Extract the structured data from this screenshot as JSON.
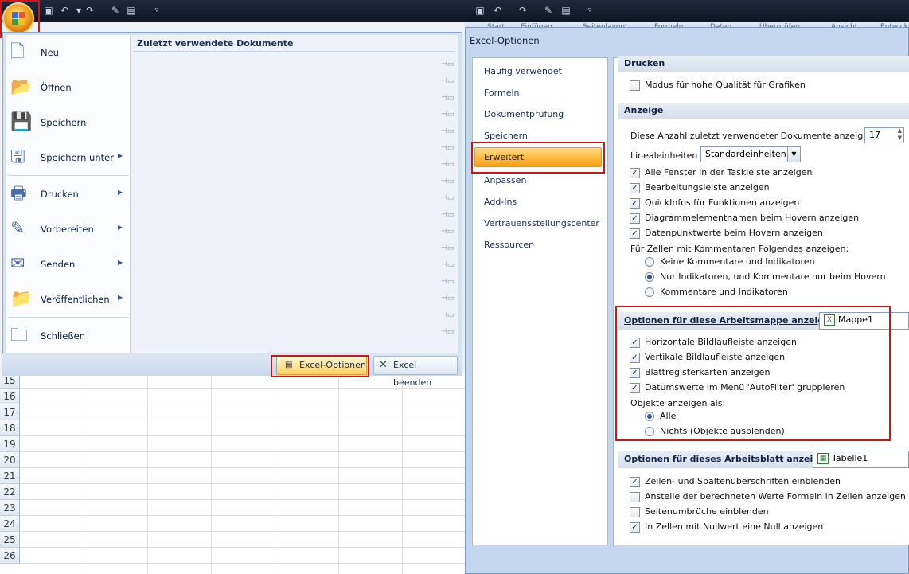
{
  "quick_access": {
    "icons": [
      "save-icon",
      "undo-icon",
      "redo-icon",
      "format-painter-icon",
      "print-preview-icon",
      "customize-arrow-icon"
    ]
  },
  "ribbon_tabs": [
    "Start",
    "Einfügen",
    "Seitenlayout",
    "Formeln",
    "Daten",
    "Überprüfen",
    "Ansicht",
    "Entwickl"
  ],
  "office_menu": {
    "items": [
      {
        "id": "neu",
        "label": "Neu",
        "has_submenu": false,
        "icon": "new-document-icon"
      },
      {
        "id": "oeffnen",
        "label": "Öffnen",
        "has_submenu": false,
        "icon": "open-folder-icon"
      },
      {
        "id": "speichern",
        "label": "Speichern",
        "has_submenu": false,
        "icon": "save-disk-icon"
      },
      {
        "id": "speichern-unter",
        "label": "Speichern unter",
        "has_submenu": true,
        "icon": "save-as-icon"
      },
      {
        "id": "drucken",
        "label": "Drucken",
        "has_submenu": true,
        "icon": "printer-icon"
      },
      {
        "id": "vorbereiten",
        "label": "Vorbereiten",
        "has_submenu": true,
        "icon": "prepare-icon"
      },
      {
        "id": "senden",
        "label": "Senden",
        "has_submenu": true,
        "icon": "send-icon"
      },
      {
        "id": "veroeffentlichen",
        "label": "Veröffentlichen",
        "has_submenu": true,
        "icon": "publish-icon"
      },
      {
        "id": "schliessen",
        "label": "Schließen",
        "has_submenu": false,
        "icon": "close-folder-icon"
      }
    ],
    "recent_title": "Zuletzt verwendete Dokumente",
    "pin_count": 17,
    "options_button": "Excel-Optionen",
    "exit_button": "Excel beenden"
  },
  "sheet": {
    "row_numbers": [
      "15",
      "16",
      "17",
      "18",
      "19",
      "20",
      "21",
      "22",
      "23",
      "24",
      "25",
      "26"
    ]
  },
  "dialog": {
    "title": "Excel-Optionen",
    "nav": [
      {
        "label": "Häufig verwendet",
        "active": false
      },
      {
        "label": "Formeln",
        "active": false
      },
      {
        "label": "Dokumentprüfung",
        "active": false
      },
      {
        "label": "Speichern",
        "active": false
      },
      {
        "label": "Erweitert",
        "active": true
      },
      {
        "label": "Anpassen",
        "active": false
      },
      {
        "label": "Add-Ins",
        "active": false
      },
      {
        "label": "Vertrauensstellungscenter",
        "active": false
      },
      {
        "label": "Ressourcen",
        "active": false
      }
    ],
    "drucken": {
      "header": "Drucken",
      "options": [
        {
          "label": "Modus für hohe Qualität für Grafiken",
          "checked": false
        }
      ]
    },
    "anzeige": {
      "header": "Anzeige",
      "recent_docs_label": "Diese Anzahl zuletzt verwendeter Dokumente anzeigen:",
      "recent_docs_value": "17",
      "ruler_label": "Linealeinheiten",
      "ruler_value": "Standardeinheiten",
      "options": [
        {
          "label": "Alle Fenster in der Taskleiste anzeigen",
          "checked": true
        },
        {
          "label": "Bearbeitungsleiste anzeigen",
          "checked": true
        },
        {
          "label": "QuickInfos für Funktionen anzeigen",
          "checked": true
        },
        {
          "label": "Diagrammelementnamen beim Hovern anzeigen",
          "checked": true
        },
        {
          "label": "Datenpunktwerte beim Hovern anzeigen",
          "checked": true
        }
      ],
      "comments_label": "Für Zellen mit Kommentaren Folgendes anzeigen:",
      "comments_radios": [
        {
          "label": "Keine Kommentare und Indikatoren",
          "selected": false
        },
        {
          "label": "Nur Indikatoren, und Kommentare nur beim Hovern",
          "selected": true
        },
        {
          "label": "Kommentare und Indikatoren",
          "selected": false
        }
      ]
    },
    "workbook": {
      "header": "Optionen für diese Arbeitsmappe anzeigen:",
      "selector": "Mappe1",
      "options": [
        {
          "label": "Horizontale Bildlaufleiste anzeigen",
          "checked": true
        },
        {
          "label": "Vertikale Bildlaufleiste anzeigen",
          "checked": true
        },
        {
          "label": "Blattregisterkarten anzeigen",
          "checked": true
        },
        {
          "label": "Datumswerte im Menü 'AutoFilter' gruppieren",
          "checked": true
        }
      ],
      "objects_label": "Objekte anzeigen als:",
      "objects_radios": [
        {
          "label": "Alle",
          "selected": true
        },
        {
          "label": "Nichts (Objekte ausblenden)",
          "selected": false
        }
      ]
    },
    "worksheet": {
      "header": "Optionen für dieses Arbeitsblatt anzeigen:",
      "selector": "Tabelle1",
      "options": [
        {
          "label": "Zeilen- und Spaltenüberschriften einblenden",
          "checked": true
        },
        {
          "label": "Anstelle der berechneten Werte Formeln in Zellen anzeigen",
          "checked": false
        },
        {
          "label": "Seitenumbrüche einblenden",
          "checked": false
        },
        {
          "label": "In Zellen mit Nullwert eine Null anzeigen",
          "checked": true
        }
      ]
    }
  }
}
